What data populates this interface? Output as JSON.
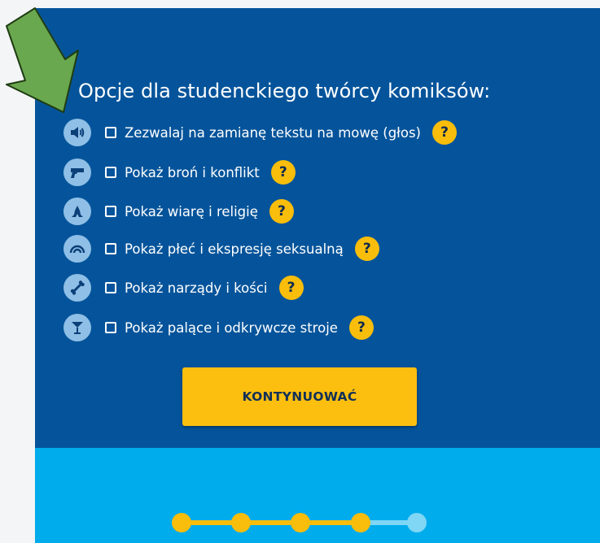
{
  "heading": "Opcje dla studenckiego twórcy komiksów:",
  "options": [
    {
      "label": "Zezwalaj na zamianę tekstu na mowę (głos)",
      "icon": "speaker-icon",
      "checked": false,
      "help": "?"
    },
    {
      "label": "Pokaż broń i konflikt",
      "icon": "gun-icon",
      "checked": false,
      "help": "?"
    },
    {
      "label": "Pokaż wiarę i religię",
      "icon": "praying-hands-icon",
      "checked": false,
      "help": "?"
    },
    {
      "label": "Pokaż płeć i ekspresję seksualną",
      "icon": "rainbow-icon",
      "checked": false,
      "help": "?"
    },
    {
      "label": "Pokaż narządy i kości",
      "icon": "bone-icon",
      "checked": false,
      "help": "?"
    },
    {
      "label": "Pokaż palące i odkrywcze stroje",
      "icon": "cocktail-glass-icon",
      "checked": false,
      "help": "?"
    }
  ],
  "continue_label": "KONTYNUOWAĆ",
  "progress": {
    "total_steps": 5,
    "current_step": 5
  },
  "colors": {
    "panel_dark": "#05549b",
    "panel_light": "#00acec",
    "accent": "#fdbf0f",
    "icon_bg": "#8fbfe6",
    "arrow": "#6aa84f"
  }
}
